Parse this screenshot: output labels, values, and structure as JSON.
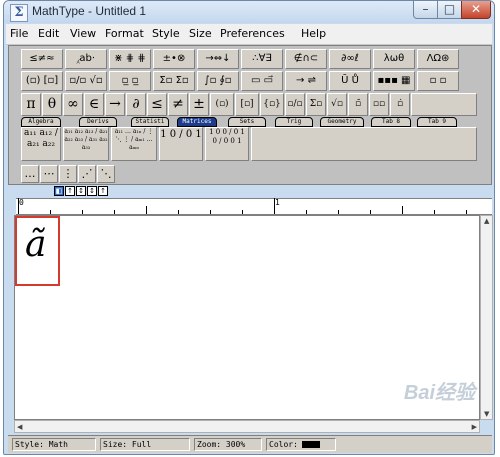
{
  "window": {
    "title": "MathType - Untitled 1",
    "min": "–",
    "max": "□",
    "close": "✕"
  },
  "menu": [
    {
      "label": "File"
    },
    {
      "label": "Edit"
    },
    {
      "label": "View"
    },
    {
      "label": "Format"
    },
    {
      "label": "Style"
    },
    {
      "label": "Size"
    },
    {
      "label": "Preferences"
    },
    {
      "label": "Help"
    }
  ],
  "palettes": {
    "row1": [
      "≤≠≈",
      "⁁ab⋅",
      "⋇ ⋕ ⋕",
      "±•⊗",
      "→⇔↓",
      "∴∀∃",
      "∉∩⊂",
      "∂∞ℓ",
      "λωθ",
      "ΛΩ⊛"
    ],
    "row2": [
      "(▫) [▫]",
      "▫/▫ √▫",
      "▫̲ ▫̲",
      "Σ▫ Σ▫",
      "∫▫ ∮▫",
      "▭ ▭⃗",
      "→ ⇌",
      "Ū Ů",
      "▪▪▪ ▦",
      "▫ ▫"
    ],
    "row3": [
      "π",
      "θ",
      "∞",
      "∈",
      "→",
      "∂",
      "≤",
      "≠",
      "±",
      "(▫)",
      "[▫]",
      "{▫}",
      "▫/▫",
      "Σ▫",
      "√▫",
      "▫̄",
      "▫▫",
      "▫̇"
    ],
    "tabs": [
      "Algebra",
      "Derivs",
      "Statisti",
      "Matrices",
      "Sets",
      "Trig",
      "Geometry",
      "Tab 8",
      "Tab 9"
    ],
    "active_tab": "Matrices",
    "matrices": [
      "a₁₁ a₁₂ / a₂₁ a₂₂",
      "a₁₁ a₁₂ a₁₃ / a₂₁ a₂₂ a₂₃ / a₃₁ a₃₂ a₃₃",
      "a₁₁ … a₁ₙ / ⋮ ⋱ ⋮ / aₘ₁ … aₘₙ",
      "1 0 / 0 1",
      "1 0 0 / 0 1 0 / 0 0 1"
    ],
    "dots": [
      "…",
      "⋯",
      "⋮",
      "⋰",
      "⋱"
    ]
  },
  "small_icons": [
    "◧",
    "↑",
    "↕",
    "↕",
    "↑"
  ],
  "ruler": {
    "label_start": "0",
    "label_mid": "1"
  },
  "formula": "ã",
  "status": {
    "style": "Style: Math",
    "size": "Size: Full",
    "zoom": "Zoom: 300%",
    "color_label": "Color:",
    "color_value": "#000000"
  },
  "watermark": "Bai经验"
}
